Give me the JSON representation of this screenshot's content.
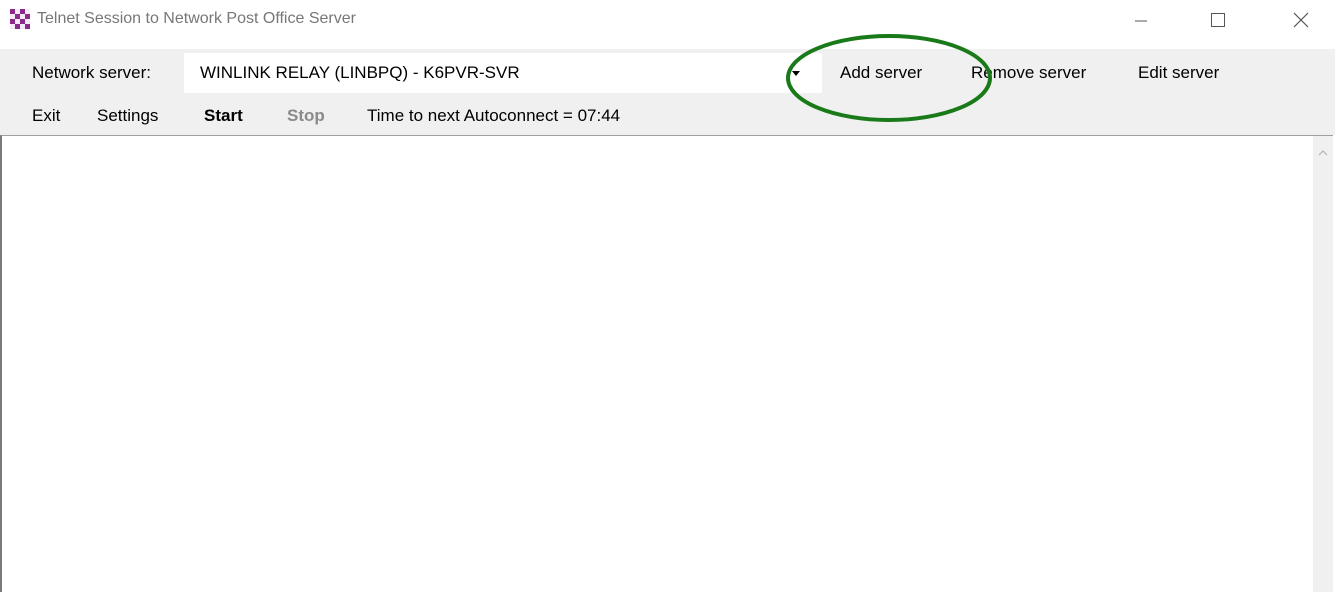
{
  "window": {
    "title": "Telnet Session to Network Post Office Server"
  },
  "toolbar": {
    "server_label": "Network server:",
    "server_value": "WINLINK RELAY (LINBPQ) - K6PVR-SVR",
    "add_server": "Add server",
    "remove_server": "Remove server",
    "edit_server": "Edit server"
  },
  "actions": {
    "exit": "Exit",
    "settings": "Settings",
    "start": "Start",
    "stop": "Stop",
    "autoconnect": "Time to next Autoconnect = 07:44"
  },
  "colors": {
    "annotation": "#1a7a1a",
    "toolbar_bg": "#f0f0f0",
    "disabled_text": "#8a8a8a"
  },
  "icons": {
    "app": "checkered-app-icon",
    "minimize": "minimize-icon",
    "maximize": "maximize-icon",
    "close": "close-icon",
    "dropdown": "chevron-down-icon",
    "scroll_up": "chevron-up-icon"
  }
}
